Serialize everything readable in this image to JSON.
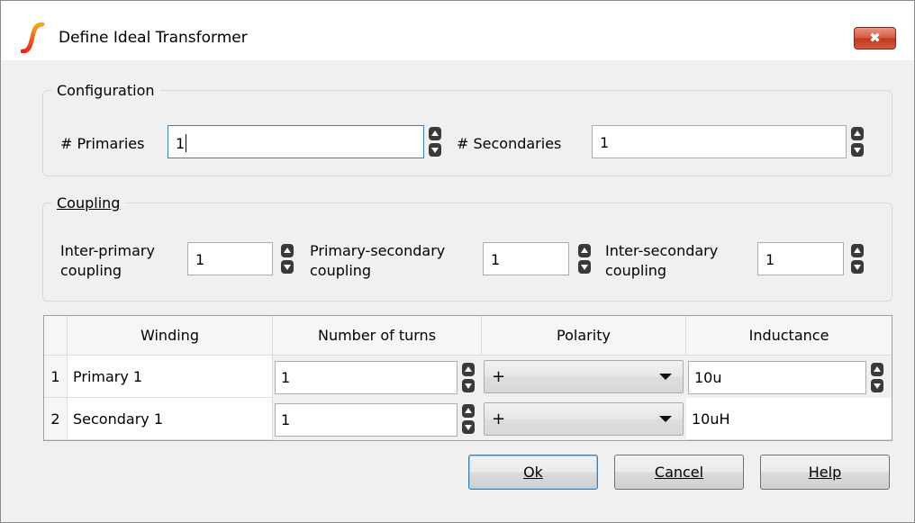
{
  "window": {
    "title": "Define Ideal Transformer",
    "close_glyph": "✖",
    "app_icon": "simetrix-logo-icon"
  },
  "configuration": {
    "group_title": "Configuration",
    "primaries_label": "# Primaries",
    "primaries_value": "1",
    "secondaries_label": "# Secondaries",
    "secondaries_value": "1"
  },
  "coupling": {
    "group_title": "Coupling",
    "inter_primary_line1": "Inter-primary",
    "inter_primary_line2": "coupling",
    "inter_primary_value": "1",
    "primary_secondary_line1": "Primary-secondary",
    "primary_secondary_line2": "coupling",
    "primary_secondary_value": "1",
    "inter_secondary_line1": "Inter-secondary",
    "inter_secondary_line2": "coupling",
    "inter_secondary_value": "1"
  },
  "table": {
    "columns": [
      "Winding",
      "Number of turns",
      "Polarity",
      "Inductance"
    ],
    "rows": [
      {
        "num": "1",
        "winding": "Primary 1",
        "turns": "1",
        "polarity": "+",
        "inductance": "10u"
      },
      {
        "num": "2",
        "winding": "Secondary 1",
        "turns": "1",
        "polarity": "+",
        "inductance": "10uH"
      }
    ]
  },
  "buttons": {
    "ok": "Ok",
    "cancel": "Cancel",
    "help": "Help"
  },
  "colors": {
    "accent_focus": "#3c7fb1",
    "close_red": "#c0381f",
    "logo_red": "#e8251e",
    "logo_yellow": "#f5a81c"
  }
}
